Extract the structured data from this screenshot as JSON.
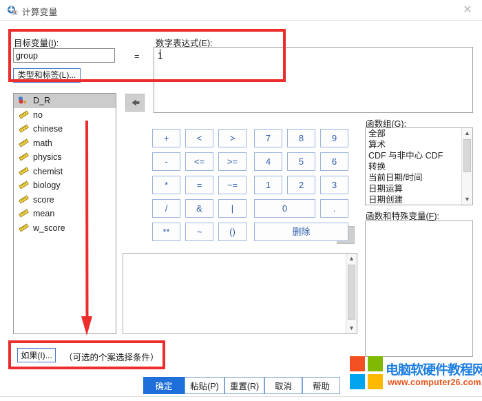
{
  "window": {
    "title": "计算变量",
    "icon": "spss-compute-icon",
    "close_label": "✕"
  },
  "target": {
    "label": "目标变量(I):",
    "label_plain": "目标变量",
    "accel": "I",
    "value": "group",
    "equals": "=",
    "type_label_button": "类型和标签(L)..."
  },
  "expression": {
    "label": "数字表达式(E):",
    "accel": "E",
    "value": "1"
  },
  "variables": {
    "items": [
      {
        "name": "D_R",
        "icon": "string-variable-icon",
        "selected": true
      },
      {
        "name": "no",
        "icon": "scale-variable-icon",
        "selected": false
      },
      {
        "name": "chinese",
        "icon": "scale-variable-icon",
        "selected": false
      },
      {
        "name": "math",
        "icon": "scale-variable-icon",
        "selected": false
      },
      {
        "name": "physics",
        "icon": "scale-variable-icon",
        "selected": false
      },
      {
        "name": "chemist",
        "icon": "scale-variable-icon",
        "selected": false
      },
      {
        "name": "biology",
        "icon": "scale-variable-icon",
        "selected": false
      },
      {
        "name": "score",
        "icon": "scale-variable-icon",
        "selected": false
      },
      {
        "name": "mean",
        "icon": "scale-variable-icon",
        "selected": false
      },
      {
        "name": "w_score",
        "icon": "scale-variable-icon",
        "selected": false
      }
    ]
  },
  "transfer_buttons": {
    "move_to_expression": "arrow-right-icon",
    "move_up": "arrow-up-icon"
  },
  "keypad": {
    "rows": [
      [
        "+",
        "<",
        ">",
        "7",
        "8",
        "9"
      ],
      [
        "-",
        "<=",
        ">=",
        "4",
        "5",
        "6"
      ],
      [
        "*",
        "=",
        "~=",
        "1",
        "2",
        "3"
      ],
      [
        "/",
        "&",
        "|",
        "0",
        "."
      ],
      [
        "**",
        "~",
        "()",
        "删除"
      ]
    ],
    "delete_label": "删除"
  },
  "function_group": {
    "label": "函数组(G):",
    "accel": "G",
    "items": [
      "全部",
      "算术",
      "CDF 与非中心 CDF",
      "转换",
      "当前日期/时间",
      "日期运算",
      "日期创建"
    ]
  },
  "functions_and_special_variables": {
    "label": "函数和特殊变量(F):",
    "accel": "F",
    "items": []
  },
  "condition": {
    "if_button": "如果(I)...",
    "hint": "（可选的个案选择条件）"
  },
  "footer": {
    "buttons": [
      {
        "label": "确定",
        "primary": true
      },
      {
        "label": "粘贴(P)",
        "primary": false
      },
      {
        "label": "重置(R)",
        "primary": false
      },
      {
        "label": "取消",
        "primary": false
      },
      {
        "label": "帮助",
        "primary": false
      }
    ]
  },
  "annotations": {
    "highlight_color": "#ec2d2d",
    "boxes": [
      "top-fields-highlight",
      "if-button-highlight"
    ],
    "arrow": "down-arrow-to-if-button"
  },
  "watermark": {
    "title": "电脑软硬件教程网",
    "url": "www.computer26.com",
    "logo_colors": [
      "#f25022",
      "#7fba00",
      "#00a4ef",
      "#ffb900"
    ]
  },
  "colors": {
    "accent": "#1e6fd9",
    "key_border": "#9bb4dd",
    "key_text": "#2a5caa",
    "annotation": "#ec2d2d"
  }
}
